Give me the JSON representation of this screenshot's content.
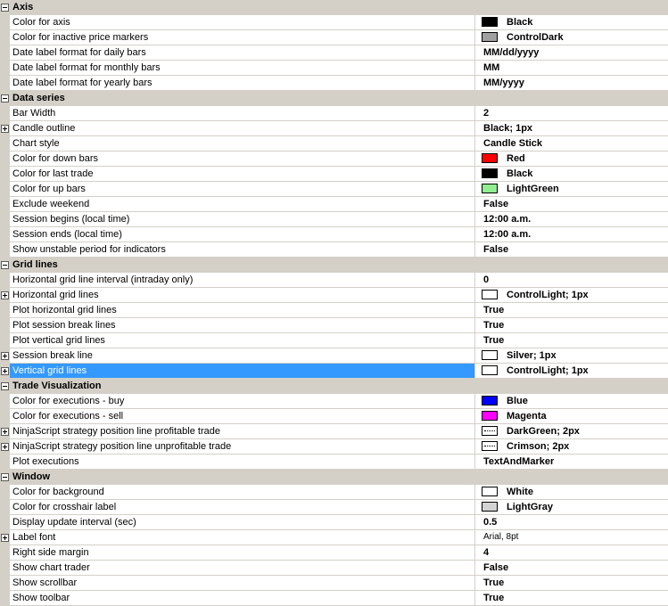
{
  "categories": [
    {
      "label": "Axis",
      "rows": [
        {
          "name": "Color for axis",
          "value": "Black",
          "swatch": "#000000"
        },
        {
          "name": "Color for inactive price markers",
          "value": "ControlDark",
          "swatch": "#a0a0a0"
        },
        {
          "name": "Date label format for daily bars",
          "value": "MM/dd/yyyy"
        },
        {
          "name": "Date label format for monthly bars",
          "value": "MM"
        },
        {
          "name": "Date label format for yearly bars",
          "value": "MM/yyyy"
        }
      ]
    },
    {
      "label": "Data series",
      "rows": [
        {
          "name": "Bar Width",
          "value": "2"
        },
        {
          "name": "Candle outline",
          "value": "Black; 1px",
          "expandable": true
        },
        {
          "name": "Chart style",
          "value": "Candle Stick"
        },
        {
          "name": "Color for down bars",
          "value": "Red",
          "swatch": "#ff0000"
        },
        {
          "name": "Color for last trade",
          "value": "Black",
          "swatch": "#000000"
        },
        {
          "name": "Color for up bars",
          "value": "LightGreen",
          "swatch": "#90ee90"
        },
        {
          "name": "Exclude weekend",
          "value": "False"
        },
        {
          "name": "Session begins (local time)",
          "value": "12:00 a.m."
        },
        {
          "name": "Session ends (local time)",
          "value": "12:00 a.m."
        },
        {
          "name": "Show unstable period for indicators",
          "value": "False"
        }
      ]
    },
    {
      "label": "Grid lines",
      "rows": [
        {
          "name": "Horizontal grid line interval (intraday only)",
          "value": "0"
        },
        {
          "name": "Horizontal grid lines",
          "value": "ControlLight; 1px",
          "swatch": "#ffffff",
          "expandable": true
        },
        {
          "name": "Plot horizontal grid lines",
          "value": "True"
        },
        {
          "name": "Plot session break lines",
          "value": "True"
        },
        {
          "name": "Plot vertical grid lines",
          "value": "True"
        },
        {
          "name": "Session break line",
          "value": "Silver; 1px",
          "swatch": "#ffffff",
          "expandable": true
        },
        {
          "name": "Vertical grid lines",
          "value": "ControlLight; 1px",
          "swatch": "#ffffff",
          "expandable": true,
          "selected": true
        }
      ]
    },
    {
      "label": "Trade Visualization",
      "rows": [
        {
          "name": "Color for executions - buy",
          "value": "Blue",
          "swatch": "#0000ff"
        },
        {
          "name": "Color for executions - sell",
          "value": "Magenta",
          "swatch": "#ff00ff"
        },
        {
          "name": "NinjaScript strategy position line profitable trade",
          "value": "DarkGreen; 2px",
          "dotted": true,
          "expandable": true
        },
        {
          "name": "NinjaScript strategy position line unprofitable trade",
          "value": "Crimson; 2px",
          "dotted": true,
          "expandable": true
        },
        {
          "name": "Plot executions",
          "value": "TextAndMarker"
        }
      ]
    },
    {
      "label": "Window",
      "rows": [
        {
          "name": "Color for background",
          "value": "White",
          "swatch": "#ffffff"
        },
        {
          "name": "Color for crosshair label",
          "value": "LightGray",
          "swatch": "#d3d3d3"
        },
        {
          "name": "Display update interval (sec)",
          "value": "0.5"
        },
        {
          "name": "Label font",
          "value": "Arial, 8pt",
          "expandable": true,
          "light": true
        },
        {
          "name": "Right side margin",
          "value": "4"
        },
        {
          "name": "Show chart trader",
          "value": "False"
        },
        {
          "name": "Show scrollbar",
          "value": "True"
        },
        {
          "name": "Show toolbar",
          "value": "True"
        }
      ]
    }
  ]
}
